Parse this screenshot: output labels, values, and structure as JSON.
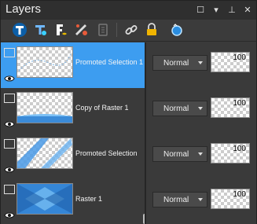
{
  "panel": {
    "title": "Layers",
    "window_buttons": [
      "☐",
      "▾",
      "⊥",
      "✕"
    ]
  },
  "toolbar": {
    "icons": [
      "new-raster-layer-icon",
      "new-vector-layer-icon",
      "new-adjustment-layer-icon",
      "mask-icon",
      "delete-layer-icon",
      "link-icon",
      "lock-icon",
      "layer-styles-icon"
    ]
  },
  "layers": [
    {
      "name": "Promoted Selection 1",
      "selected": true,
      "blend": "Normal",
      "opacity": "100"
    },
    {
      "name": "Copy of Raster 1",
      "selected": false,
      "blend": "Normal",
      "opacity": "100"
    },
    {
      "name": "Promoted Selection",
      "selected": false,
      "blend": "Normal",
      "opacity": "100"
    },
    {
      "name": "Raster 1",
      "selected": false,
      "blend": "Normal",
      "opacity": "100"
    }
  ],
  "colors": {
    "selection": "#3d9df0",
    "background": "#3b3b3b"
  }
}
